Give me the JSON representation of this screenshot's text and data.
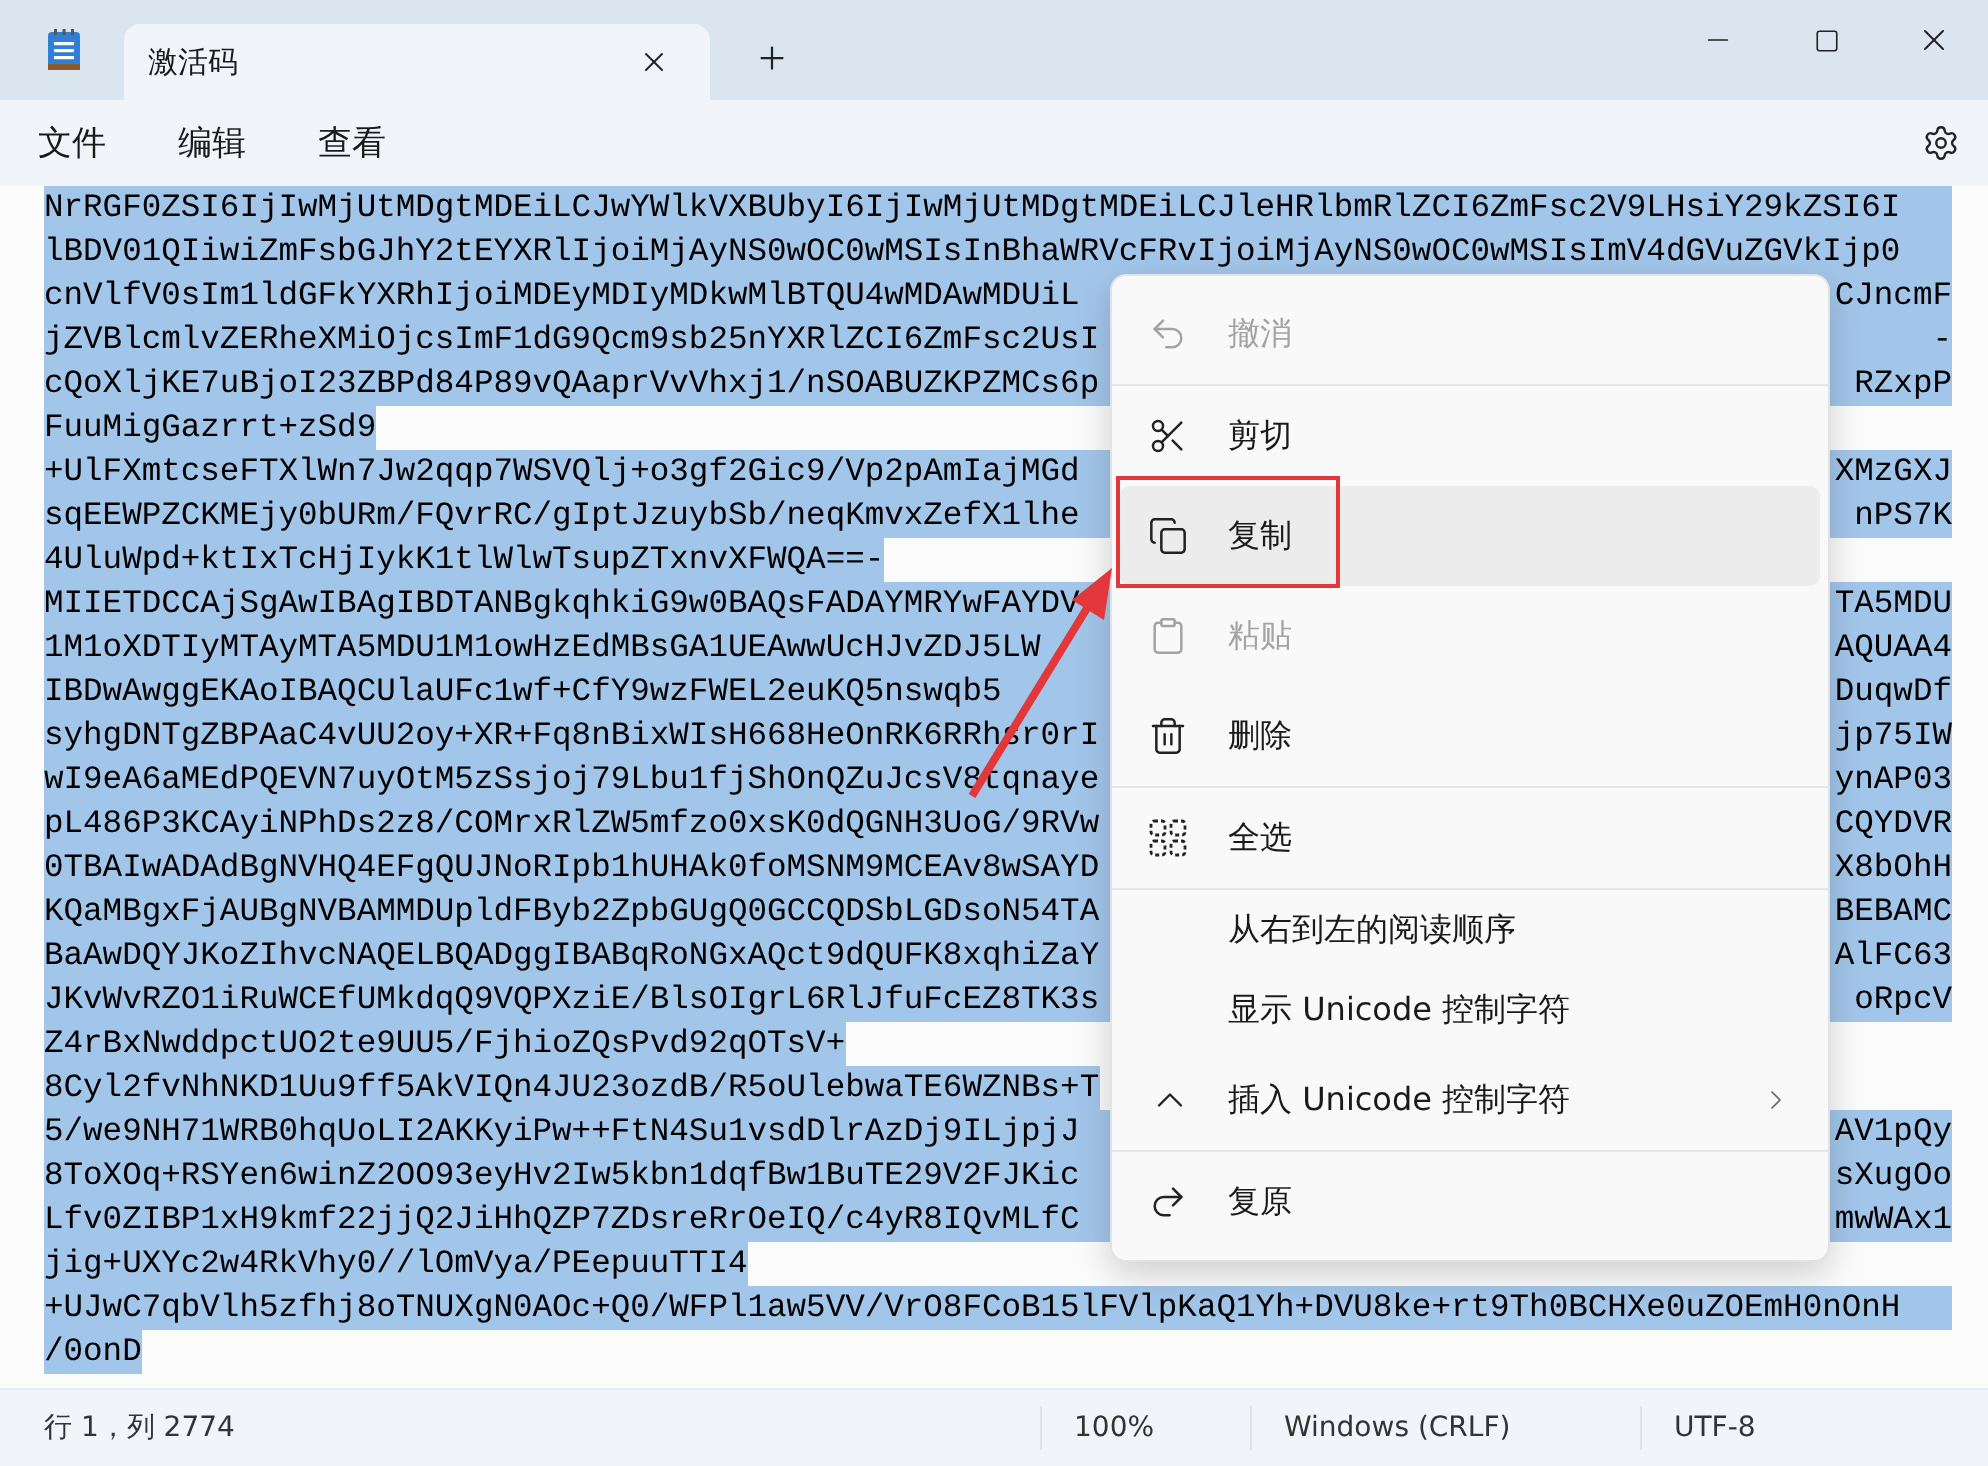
{
  "window": {
    "tab": {
      "title": "激活码",
      "selected": true
    }
  },
  "menubar": {
    "items": [
      "文件",
      "编辑",
      "查看"
    ]
  },
  "editor": {
    "text_selected": true,
    "lines": [
      {
        "text": "NrRGF0ZSI6IjIwMjUtMDgtMDEiLCJwYWlkVXBUbyI6IjIwMjUtMDgtMDEiLCJleHRlbmRlZCI6ZmFsc2V9LHsiY29kZSI6I",
        "wrapped": true
      },
      {
        "text": "lBDV01QIiwiZmFsbGJhY2tEYXRlIjoiMjAyNS0wOC0wMSIsInBhaWRVcFRvIjoiMjAyNS0wOC0wMSIsImV4dGVuZGVkIjp0",
        "wrapped": true
      },
      {
        "text": "cnVlfV0sIm1ldGFkYXRhIjoiMDEyMDIyMDkwMlBTQU4wMDAwMDUiL",
        "tail": "CJncmF",
        "wrapped": true
      },
      {
        "text": "jZVBlcmlvZERheXMiOjcsImF1dG9Qcm9sb25nYXRlZCI6ZmFsc2UsI",
        "tail": "-",
        "wrapped": true
      },
      {
        "text": "cQoXljKE7uBjoI23ZBPd84P89vQAaprVvVhxj1/nSOABUZKPZMCs6p",
        "tail": "RZxpP",
        "wrapped": true
      },
      {
        "text": "FuuMigGazrrt+zSd9",
        "wrapped": false
      },
      {
        "text": "+UlFXmtcseFTXlWn7Jw2qqp7WSVQlj+o3gf2Gic9/Vp2pAmIajMGd",
        "tail": "XMzGXJ",
        "wrapped": true
      },
      {
        "text": "sqEEWPZCKMEjy0bURm/FQvrRC/gIptJzuybSb/neqKmvxZefX1lhe",
        "tail": "nPS7K",
        "wrapped": true
      },
      {
        "text": "4UluWpd+ktIxTcHjIykK1tlWlwTsupZTxnvXFWQA==-",
        "wrapped": false
      },
      {
        "text": "MIIETDCCAjSgAwIBAgIBDTANBgkqhkiG9w0BAQsFADAYMRYwFAYDV",
        "tail": "TA5MDU",
        "wrapped": true
      },
      {
        "text": "1M1oXDTIyMTAyMTA5MDU1M1owHzEdMBsGA1UEAwwUcHJvZDJ5LW",
        "tail": "AQUAA4",
        "wrapped": true
      },
      {
        "text": "IBDwAwggEKAoIBAQCUlaUFc1wf+CfY9wzFWEL2euKQ5nswqb5",
        "tail": "DuqwDf",
        "wrapped": true
      },
      {
        "text": "syhgDNTgZBPAaC4vUU2oy+XR+Fq8nBixWIsH668HeOnRK6RRhsr0rI",
        "tail": "jp75IW",
        "wrapped": true
      },
      {
        "text": "wI9eA6aMEdPQEVN7uyOtM5zSsjoj79Lbu1fjShOnQZuJcsV8tqnaye",
        "tail": "ynAP03",
        "wrapped": true
      },
      {
        "text": "pL486P3KCAyiNPhDs2z8/COMrxRlZW5mfzo0xsK0dQGNH3UoG/9RVw",
        "tail": "CQYDVR",
        "wrapped": true
      },
      {
        "text": "0TBAIwADAdBgNVHQ4EFgQUJNoRIpb1hUHAk0foMSNM9MCEAv8wSAYD",
        "tail": "X8bOhH",
        "wrapped": true
      },
      {
        "text": "KQaMBgxFjAUBgNVBAMMDUpldFByb2ZpbGUgQ0GCCQDSbLGDsoN54TA",
        "tail": "BEBAMC",
        "wrapped": true
      },
      {
        "text": "BaAwDQYJKoZIhvcNAQELBQADggIBABqRoNGxAQct9dQUFK8xqhiZaY",
        "tail": "AlFC63",
        "wrapped": true
      },
      {
        "text": "JKvWvRZO1iRuWCEfUMkdqQ9VQPXziE/BlsOIgrL6RlJfuFcEZ8TK3s",
        "tail": "oRpcV",
        "wrapped": true
      },
      {
        "text": "Z4rBxNwddpctUO2te9UU5/FjhioZQsPvd92qOTsV+",
        "wrapped": false
      },
      {
        "text": "8Cyl2fvNhNKD1Uu9ff5AkVIQn4JU23ozdB/R5oUlebwaTE6WZNBs+T",
        "wrapped": false
      },
      {
        "text": "5/we9NH71WRB0hqUoLI2AKKyiPw++FtN4Su1vsdDlrAzDj9ILjpjJ",
        "tail": "AV1pQy",
        "wrapped": true
      },
      {
        "text": "8ToXOq+RSYen6winZ2OO93eyHv2Iw5kbn1dqfBw1BuTE29V2FJKic",
        "tail": "sXugOo",
        "wrapped": true
      },
      {
        "text": "Lfv0ZIBP1xH9kmf22jjQ2JiHhQZP7ZDsreRrOeIQ/c4yR8IQvMLfC",
        "tail": "mwWAx1",
        "wrapped": true
      },
      {
        "text": "jig+UXYc2w4RkVhy0//lOmVya/PEepuuTTI4",
        "wrapped": false
      },
      {
        "text": "+UJwC7qbVlh5zfhj8oTNUXgN0AOc+Q0/WFPl1aw5VV/VrO8FCoB15lFVlpKaQ1Yh+DVU8ke+rt9Th0BCHXe0uZOEmH0nOnH",
        "wrapped": true
      },
      {
        "text": "/0onD",
        "wrapped": false
      }
    ]
  },
  "context_menu": {
    "items": [
      {
        "kind": "item",
        "label": "撤消",
        "disabled": true,
        "selected": false
      },
      {
        "kind": "separator"
      },
      {
        "kind": "item",
        "label": "剪切",
        "disabled": false,
        "selected": false
      },
      {
        "kind": "item",
        "label": "复制",
        "disabled": false,
        "selected": true
      },
      {
        "kind": "item",
        "label": "粘贴",
        "disabled": true,
        "selected": false
      },
      {
        "kind": "item",
        "label": "删除",
        "disabled": false,
        "selected": false
      },
      {
        "kind": "separator"
      },
      {
        "kind": "item",
        "label": "全选",
        "disabled": false,
        "selected": false
      },
      {
        "kind": "separator"
      },
      {
        "kind": "plain",
        "label": "从右到左的阅读顺序",
        "disabled": false,
        "selected": false
      },
      {
        "kind": "plain",
        "label": "显示 Unicode 控制字符",
        "disabled": false,
        "selected": false
      },
      {
        "kind": "submenu",
        "label": "插入 Unicode 控制字符",
        "disabled": false,
        "selected": false
      },
      {
        "kind": "separator"
      },
      {
        "kind": "item",
        "label": "复原",
        "disabled": false,
        "selected": false
      }
    ]
  },
  "status_bar": {
    "position": "行 1，列 2774",
    "zoom": "100%",
    "line_ending": "Windows (CRLF)",
    "encoding": "UTF-8"
  }
}
